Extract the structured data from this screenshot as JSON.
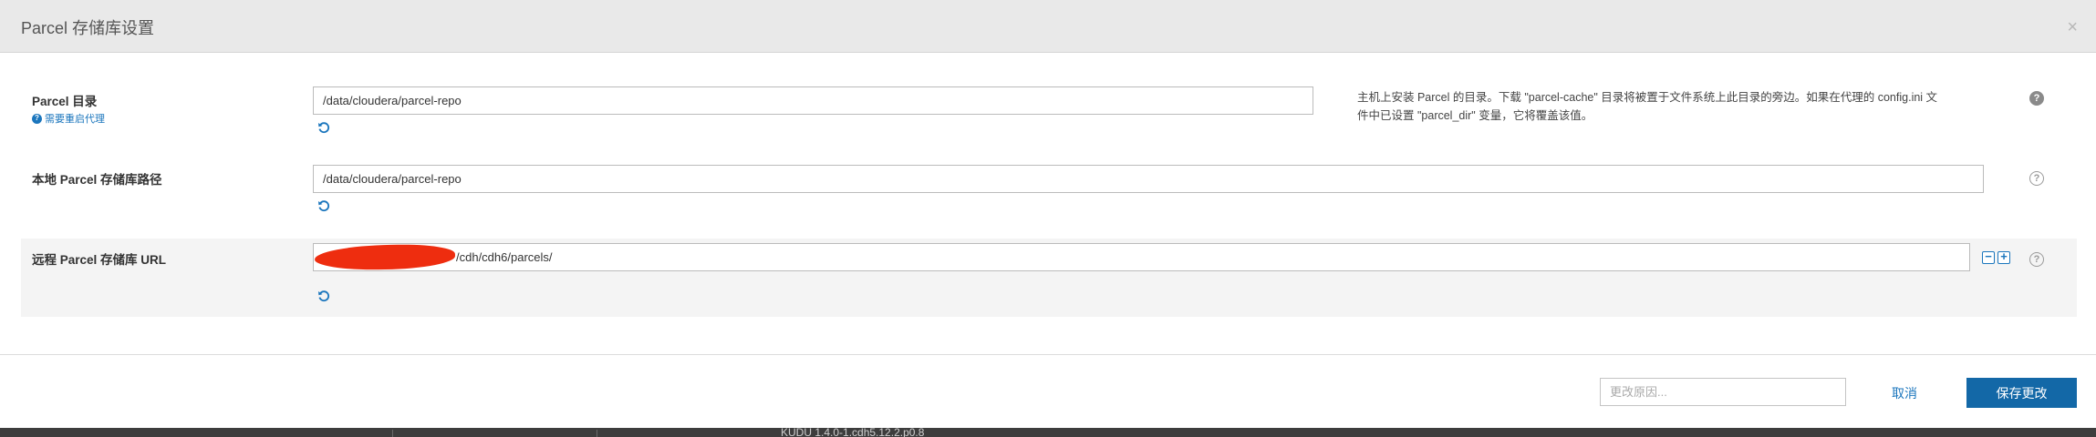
{
  "dialog": {
    "title": "Parcel 存储库设置",
    "close_glyph": "×"
  },
  "settings": [
    {
      "label": "Parcel 目录",
      "sublink": "需要重启代理",
      "value": "/data/cloudera/parcel-repo",
      "description_line1": "主机上安装 Parcel 的目录。下载 \"parcel-cache\" 目录将被置于文件系统上此目录的旁边。如果在代理的 config.ini 文",
      "description_line2": "件中已设置 \"parcel_dir\" 变量，它将覆盖该值。"
    },
    {
      "label": "本地 Parcel 存储库路径",
      "value": "/data/cloudera/parcel-repo"
    },
    {
      "label": "远程 Parcel 存储库 URL",
      "value_visible_suffix": "/cdh/cdh6/parcels/"
    }
  ],
  "icons": {
    "reset": "reset-icon",
    "help": "question-icon",
    "remove": "minus-icon",
    "add": "plus-icon"
  },
  "footer": {
    "reason_placeholder": "更改原因...",
    "cancel_label": "取消",
    "save_label": "保存更改"
  },
  "background_peek": {
    "text": "KUDU 1.4.0-1.cdh5.12.2.p0.8"
  },
  "colors": {
    "accent": "#1b76bd",
    "primary_button": "#1368a7",
    "header_bg": "#e9e9e9",
    "redaction": "#ee2d0f"
  }
}
